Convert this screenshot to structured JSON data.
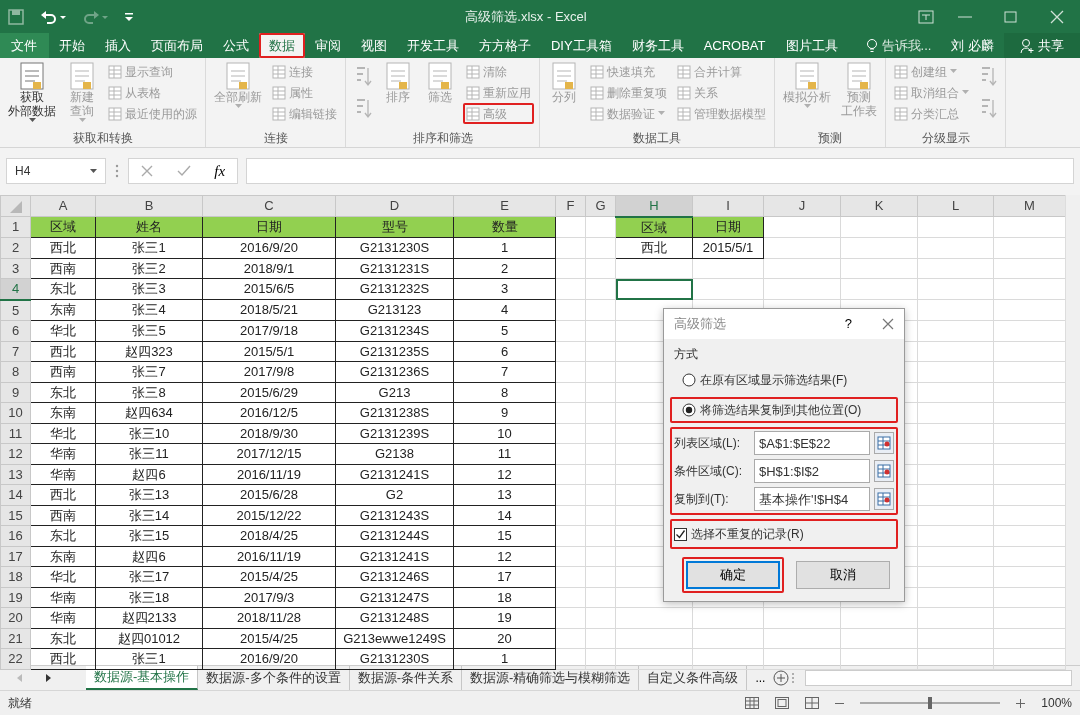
{
  "window": {
    "title": "高级筛选.xlsx - Excel"
  },
  "ribbon_tabs": [
    {
      "label": "文件",
      "kind": "file",
      "selected": false,
      "highlighted": false
    },
    {
      "label": "开始",
      "kind": "tab",
      "selected": false,
      "highlighted": false
    },
    {
      "label": "插入",
      "kind": "tab",
      "selected": false,
      "highlighted": false
    },
    {
      "label": "页面布局",
      "kind": "tab",
      "selected": false,
      "highlighted": false
    },
    {
      "label": "公式",
      "kind": "tab",
      "selected": false,
      "highlighted": false
    },
    {
      "label": "数据",
      "kind": "tab",
      "selected": true,
      "highlighted": true
    },
    {
      "label": "审阅",
      "kind": "tab",
      "selected": false,
      "highlighted": false
    },
    {
      "label": "视图",
      "kind": "tab",
      "selected": false,
      "highlighted": false
    },
    {
      "label": "开发工具",
      "kind": "tab",
      "selected": false,
      "highlighted": false
    },
    {
      "label": "方方格子",
      "kind": "tab",
      "selected": false,
      "highlighted": false
    },
    {
      "label": "DIY工具箱",
      "kind": "tab",
      "selected": false,
      "highlighted": false
    },
    {
      "label": "财务工具",
      "kind": "tab",
      "selected": false,
      "highlighted": false
    },
    {
      "label": "ACROBAT",
      "kind": "tab",
      "selected": false,
      "highlighted": false
    },
    {
      "label": "图片工具",
      "kind": "tab",
      "selected": false,
      "highlighted": false
    }
  ],
  "tell_me": "告诉我...",
  "user": "刘 必麟",
  "share_button": "共享",
  "ribbon_groups": [
    {
      "label": "获取和转换",
      "columns": [
        [
          {
            "kind": "big",
            "lines": [
              "获取",
              "外部数据"
            ],
            "dropdown": true,
            "disabled": false
          }
        ],
        [
          {
            "kind": "big",
            "lines": [
              "新建",
              "查询"
            ],
            "dropdown": true,
            "disabled": true
          }
        ],
        [
          {
            "kind": "small",
            "label": "显示查询",
            "disabled": true
          },
          {
            "kind": "small",
            "label": "从表格",
            "disabled": true
          },
          {
            "kind": "small",
            "label": "最近使用的源",
            "disabled": true
          }
        ]
      ]
    },
    {
      "label": "连接",
      "columns": [
        [
          {
            "kind": "big",
            "lines": [
              "全部刷新"
            ],
            "dropdown": true,
            "disabled": true
          }
        ],
        [
          {
            "kind": "small",
            "label": "连接",
            "disabled": true
          },
          {
            "kind": "small",
            "label": "属性",
            "disabled": true
          },
          {
            "kind": "small",
            "label": "编辑链接",
            "disabled": true
          }
        ]
      ]
    },
    {
      "label": "排序和筛选",
      "columns": [
        [
          {
            "kind": "icon",
            "disabled": true
          },
          {
            "kind": "icon",
            "disabled": true
          }
        ],
        [
          {
            "kind": "big",
            "lines": [
              "排序"
            ],
            "disabled": true
          }
        ],
        [
          {
            "kind": "big",
            "lines": [
              "筛选"
            ],
            "disabled": true
          }
        ],
        [
          {
            "kind": "small",
            "label": "清除",
            "disabled": true
          },
          {
            "kind": "small",
            "label": "重新应用",
            "disabled": true
          },
          {
            "kind": "small",
            "label": "高级",
            "disabled": true,
            "highlighted": true
          }
        ]
      ]
    },
    {
      "label": "数据工具",
      "columns": [
        [
          {
            "kind": "big",
            "lines": [
              "分列"
            ],
            "disabled": true
          }
        ],
        [
          {
            "kind": "small",
            "label": "快速填充",
            "disabled": true
          },
          {
            "kind": "small",
            "label": "删除重复项",
            "disabled": true
          },
          {
            "kind": "small",
            "label": "数据验证",
            "dropdown": true,
            "disabled": true
          }
        ],
        [
          {
            "kind": "small",
            "label": "合并计算",
            "disabled": true
          },
          {
            "kind": "small",
            "label": "关系",
            "disabled": true
          },
          {
            "kind": "small",
            "label": "管理数据模型",
            "disabled": true
          }
        ]
      ]
    },
    {
      "label": "预测",
      "columns": [
        [
          {
            "kind": "big",
            "lines": [
              "模拟分析"
            ],
            "dropdown": true,
            "disabled": true
          }
        ],
        [
          {
            "kind": "big",
            "lines": [
              "预测",
              "工作表"
            ],
            "disabled": true
          }
        ]
      ]
    },
    {
      "label": "分级显示",
      "columns": [
        [
          {
            "kind": "small",
            "label": "创建组",
            "dropdown": true,
            "disabled": true
          },
          {
            "kind": "small",
            "label": "取消组合",
            "dropdown": true,
            "disabled": true
          },
          {
            "kind": "small",
            "label": "分类汇总",
            "disabled": true
          }
        ],
        [
          {
            "kind": "icon",
            "disabled": true
          },
          {
            "kind": "icon",
            "disabled": true
          }
        ]
      ]
    }
  ],
  "formula_bar": {
    "name_box": "H4",
    "function_label": "fx"
  },
  "sheet": {
    "columns": [
      {
        "label": "A",
        "selected": false
      },
      {
        "label": "B",
        "selected": false
      },
      {
        "label": "C",
        "selected": false
      },
      {
        "label": "D",
        "selected": false
      },
      {
        "label": "E",
        "selected": false
      },
      {
        "label": "F",
        "selected": false
      },
      {
        "label": "G",
        "selected": false
      },
      {
        "label": "H",
        "selected": true
      },
      {
        "label": "I",
        "selected": false
      },
      {
        "label": "J",
        "selected": false
      },
      {
        "label": "K",
        "selected": false
      },
      {
        "label": "L",
        "selected": false
      },
      {
        "label": "M",
        "selected": false
      }
    ],
    "rows": [
      {
        "number": "1",
        "selected": false,
        "header": true,
        "cells": {
          "A": "区域",
          "B": "姓名",
          "C": "日期",
          "D": "型号",
          "E": "数量",
          "H": "区域",
          "I": "日期"
        }
      },
      {
        "number": "2",
        "selected": false,
        "cells": {
          "A": "西北",
          "B": "张三1",
          "C": "2016/9/20",
          "D": "G2131230S",
          "E": "1",
          "H": "西北",
          "I": "2015/5/1"
        }
      },
      {
        "number": "3",
        "selected": false,
        "cells": {
          "A": "西南",
          "B": "张三2",
          "C": "2018/9/1",
          "D": "G2131231S",
          "E": "2"
        }
      },
      {
        "number": "4",
        "selected": true,
        "cells": {
          "A": "东北",
          "B": "张三3",
          "C": "2015/6/5",
          "D": "G2131232S",
          "E": "3"
        }
      },
      {
        "number": "5",
        "selected": false,
        "cells": {
          "A": "东南",
          "B": "张三4",
          "C": "2018/5/21",
          "D": "G213123",
          "E": "4"
        }
      },
      {
        "number": "6",
        "selected": false,
        "cells": {
          "A": "华北",
          "B": "张三5",
          "C": "2017/9/18",
          "D": "G2131234S",
          "E": "5"
        }
      },
      {
        "number": "7",
        "selected": false,
        "cells": {
          "A": "西北",
          "B": "赵四323",
          "C": "2015/5/1",
          "D": "G2131235S",
          "E": "6"
        }
      },
      {
        "number": "8",
        "selected": false,
        "cells": {
          "A": "西南",
          "B": "张三7",
          "C": "2017/9/8",
          "D": "G2131236S",
          "E": "7"
        }
      },
      {
        "number": "9",
        "selected": false,
        "cells": {
          "A": "东北",
          "B": "张三8",
          "C": "2015/6/29",
          "D": "G213",
          "E": "8"
        }
      },
      {
        "number": "10",
        "selected": false,
        "cells": {
          "A": "东南",
          "B": "赵四634",
          "C": "2016/12/5",
          "D": "G2131238S",
          "E": "9"
        }
      },
      {
        "number": "11",
        "selected": false,
        "cells": {
          "A": "华北",
          "B": "张三10",
          "C": "2018/9/30",
          "D": "G2131239S",
          "E": "10"
        }
      },
      {
        "number": "12",
        "selected": false,
        "cells": {
          "A": "华南",
          "B": "张三11",
          "C": "2017/12/15",
          "D": "G2138",
          "E": "11"
        }
      },
      {
        "number": "13",
        "selected": false,
        "cells": {
          "A": "华南",
          "B": "赵四6",
          "C": "2016/11/19",
          "D": "G2131241S",
          "E": "12"
        }
      },
      {
        "number": "14",
        "selected": false,
        "cells": {
          "A": "西北",
          "B": "张三13",
          "C": "2015/6/28",
          "D": "G2",
          "E": "13"
        }
      },
      {
        "number": "15",
        "selected": false,
        "cells": {
          "A": "西南",
          "B": "张三14",
          "C": "2015/12/22",
          "D": "G2131243S",
          "E": "14"
        }
      },
      {
        "number": "16",
        "selected": false,
        "cells": {
          "A": "东北",
          "B": "张三15",
          "C": "2018/4/25",
          "D": "G2131244S",
          "E": "15"
        }
      },
      {
        "number": "17",
        "selected": false,
        "cells": {
          "A": "东南",
          "B": "赵四6",
          "C": "2016/11/19",
          "D": "G2131241S",
          "E": "12"
        }
      },
      {
        "number": "18",
        "selected": false,
        "cells": {
          "A": "华北",
          "B": "张三17",
          "C": "2015/4/25",
          "D": "G2131246S",
          "E": "17"
        }
      },
      {
        "number": "19",
        "selected": false,
        "cells": {
          "A": "华南",
          "B": "张三18",
          "C": "2017/9/3",
          "D": "G2131247S",
          "E": "18"
        }
      },
      {
        "number": "20",
        "selected": false,
        "cells": {
          "A": "华南",
          "B": "赵四2133",
          "C": "2018/11/28",
          "D": "G2131248S",
          "E": "19"
        }
      },
      {
        "number": "21",
        "selected": false,
        "cells": {
          "A": "东北",
          "B": "赵四01012",
          "C": "2015/4/25",
          "D": "G213ewwe1249S",
          "E": "20"
        }
      },
      {
        "number": "22",
        "selected": false,
        "cells": {
          "A": "西北",
          "B": "张三1",
          "C": "2016/9/20",
          "D": "G2131230S",
          "E": "1"
        }
      }
    ]
  },
  "dialog": {
    "title": "高级筛选",
    "help": "?",
    "section_label": "方式",
    "options": [
      {
        "label": "在原有区域显示筛选结果(F)",
        "selected": false,
        "highlighted": false
      },
      {
        "label": "将筛选结果复制到其他位置(O)",
        "selected": true,
        "highlighted": true
      }
    ],
    "fields_highlighted": true,
    "fields": [
      {
        "label": "列表区域(L):",
        "value": "$A$1:$E$22"
      },
      {
        "label": "条件区域(C):",
        "value": "$H$1:$I$2"
      },
      {
        "label": "复制到(T):",
        "value": "基本操作'!$H$4"
      }
    ],
    "unique_only": {
      "label": "选择不重复的记录(R)",
      "checked": true,
      "highlighted": true
    },
    "buttons": [
      {
        "label": "确定",
        "default": true,
        "highlighted": true
      },
      {
        "label": "取消",
        "default": false,
        "highlighted": false
      }
    ]
  },
  "sheet_tabs": [
    {
      "label": "数据源-基本操作",
      "selected": true
    },
    {
      "label": "数据源-多个条件的设置",
      "selected": false
    },
    {
      "label": "数据源-条件关系",
      "selected": false
    },
    {
      "label": "数据源-精确筛选与模糊筛选",
      "selected": false
    },
    {
      "label": "自定义条件高级",
      "selected": false
    }
  ],
  "more_tabs": "...",
  "status_bar": {
    "status": "就绪",
    "zoom": "100%",
    "level": 0.5
  }
}
